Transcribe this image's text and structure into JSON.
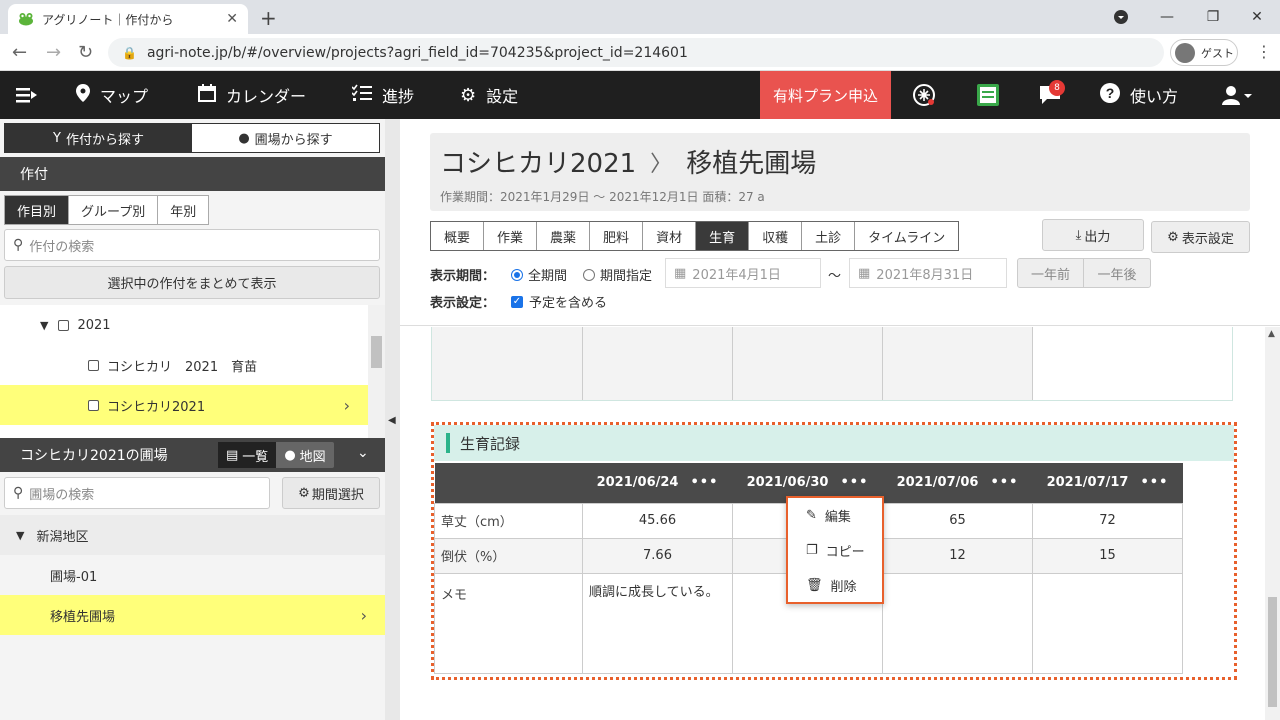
{
  "browser": {
    "tab_title": "アグリノート｜作付から",
    "url": "agri-note.jp/b/#/overview/projects?agri_field_id=704235&project_id=214601",
    "profile_label": "ゲスト"
  },
  "nav": {
    "items": [
      {
        "label": "マップ",
        "icon": "map-pin-icon"
      },
      {
        "label": "カレンダー",
        "icon": "calendar-icon"
      },
      {
        "label": "進捗",
        "icon": "checklist-icon"
      },
      {
        "label": "設定",
        "icon": "gear-icon"
      }
    ],
    "promo_label": "有料プラン申込",
    "help_label": "使い方",
    "notification_count": "8",
    "news_icon_text": "農業\n新聞"
  },
  "sidebar": {
    "mode_tabs": [
      "作付から探す",
      "圃場から探す"
    ],
    "crop_section_title": "作付",
    "crop_tabs": [
      "作目別",
      "グループ別",
      "年別"
    ],
    "crop_search_placeholder": "作付の検索",
    "show_selected_label": "選択中の作付をまとめて表示",
    "tree": [
      {
        "label": "2021"
      },
      {
        "label": "コシヒカリ　2021　育苗"
      },
      {
        "label": "コシヒカリ2021"
      }
    ],
    "field_section_title": "コシヒカリ2021の圃場",
    "view_toggle": [
      "一覧",
      "地図"
    ],
    "field_search_placeholder": "圃場の検索",
    "period_button": "期間選択",
    "fields": [
      {
        "label": "新潟地区"
      },
      {
        "label": "圃場-01"
      },
      {
        "label": "移植先圃場"
      }
    ]
  },
  "main": {
    "title_crop": "コシヒカリ2021",
    "title_field": "移植先圃場",
    "subtitle": "作業期間：2021年1月29日 ～ 2021年12月1日  面積：27 a",
    "tabs": [
      "概要",
      "作業",
      "農薬",
      "肥料",
      "資材",
      "生育",
      "収穫",
      "土診",
      "タイムライン"
    ],
    "export_label": "出力",
    "display_settings_label": "表示設定",
    "period_label": "表示期間：",
    "radio_all": "全期間",
    "radio_specified": "期間指定",
    "date_from": "2021年4月1日",
    "date_to": "2021年8月31日",
    "date_sep": "～",
    "prev_year": "一年前",
    "next_year": "一年後",
    "settings_label": "表示設定：",
    "include_planned": "予定を含める",
    "growth": {
      "section_title": "生育記録",
      "dates": [
        "2021/06/24",
        "2021/06/30",
        "2021/07/06",
        "2021/07/17"
      ],
      "rows": [
        {
          "label": "草丈（cm）",
          "values": [
            "45.66",
            "",
            "65",
            "72"
          ]
        },
        {
          "label": "倒伏（%）",
          "values": [
            "7.66",
            "",
            "12",
            "15"
          ]
        },
        {
          "label": "メモ",
          "values": [
            "順調に成長している。",
            "",
            "",
            ""
          ]
        }
      ]
    },
    "context_menu": [
      "編集",
      "コピー",
      "削除"
    ]
  },
  "colors": {
    "nav_bg": "#1f1f1f",
    "promo_bg": "#e9534f",
    "highlight": "#ffff7a",
    "accent_green": "#2bb38a",
    "outline_orange": "#e8602c"
  }
}
